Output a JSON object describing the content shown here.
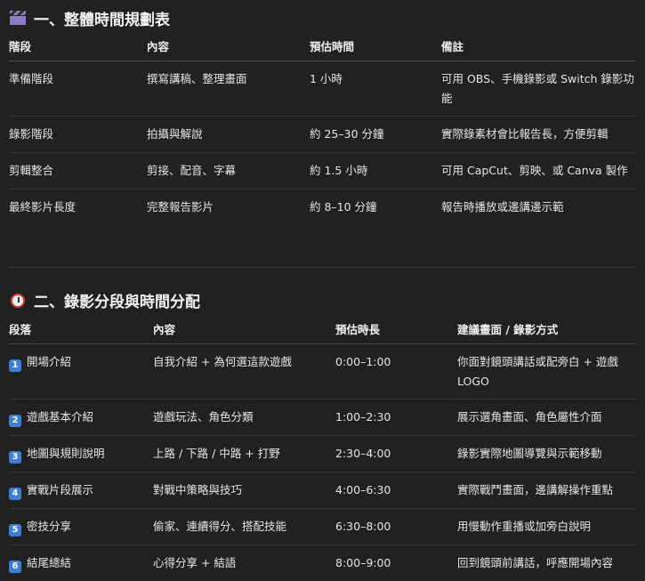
{
  "section1": {
    "icon": "clapperboard-icon",
    "title": "一、整體時間規劃表",
    "headers": [
      "階段",
      "內容",
      "預估時間",
      "備註"
    ],
    "rows": [
      [
        "準備階段",
        "撰寫講稿、整理畫面",
        "1 小時",
        "可用 OBS、手機錄影或 Switch 錄影功能"
      ],
      [
        "錄影階段",
        "拍攝與解說",
        "約 25–30 分鐘",
        "實際錄素材會比報告長，方便剪輯"
      ],
      [
        "剪輯整合",
        "剪接、配音、字幕",
        "約 1.5 小時",
        "可用 CapCut、剪映、或 Canva 製作"
      ],
      [
        "最終影片長度",
        "完整報告影片",
        "約 8–10 分鐘",
        "報告時播放或邊講邊示範"
      ]
    ]
  },
  "section2": {
    "icon": "alarm-clock-icon",
    "title": "二、錄影分段與時間分配",
    "headers": [
      "段落",
      "內容",
      "預估時長",
      "建議畫面 / 錄影方式"
    ],
    "rows": [
      [
        "1",
        "開場介紹",
        "自我介紹 + 為何選這款遊戲",
        "0:00–1:00",
        "你面對鏡頭講話或配旁白 + 遊戲 LOGO"
      ],
      [
        "2",
        "遊戲基本介紹",
        "遊戲玩法、角色分類",
        "1:00–2:30",
        "展示選角畫面、角色屬性介面"
      ],
      [
        "3",
        "地圖與規則說明",
        "上路 / 下路 / 中路 + 打野",
        "2:30–4:00",
        "錄影實際地圖導覽與示範移動"
      ],
      [
        "4",
        "實戰片段展示",
        "對戰中策略與技巧",
        "4:00–6:30",
        "實際戰鬥畫面，邊講解操作重點"
      ],
      [
        "5",
        "密技分享",
        "偷家、連續得分、搭配技能",
        "6:30–8:00",
        "用慢動作重播或加旁白說明"
      ],
      [
        "6",
        "結尾總結",
        "心得分享 + 結語",
        "8:00–9:00",
        "回到鏡頭前講話，呼應開場內容"
      ]
    ]
  }
}
